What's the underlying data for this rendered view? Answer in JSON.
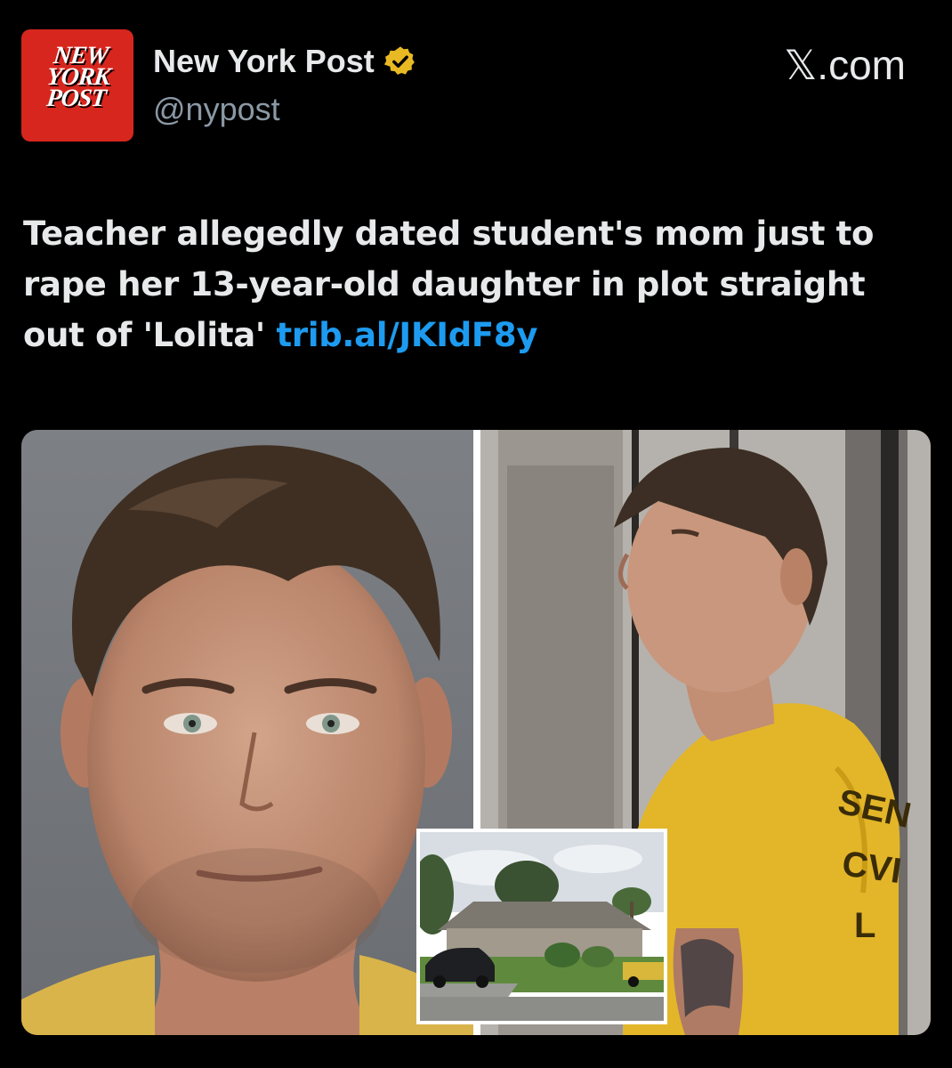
{
  "account": {
    "logo_lines": [
      "NEW",
      "YORK",
      "POST"
    ],
    "display_name": "New York Post",
    "handle": "@nypost",
    "verified_icon": "verified-badge-icon",
    "source": "𝕏.com"
  },
  "post": {
    "headline": "Teacher allegedly dated student's mom just to rape her 13-year-old daughter in plot straight out of 'Lolita'",
    "link": "trib.al/JKIdF8y"
  },
  "media": {
    "shirt_text_lines": [
      "SEN",
      "CVI",
      "L"
    ]
  },
  "colors": {
    "background": "#000000",
    "link": "#1d9bf0",
    "logo_red": "#d7261e",
    "verified_gold": "#e8b923"
  }
}
